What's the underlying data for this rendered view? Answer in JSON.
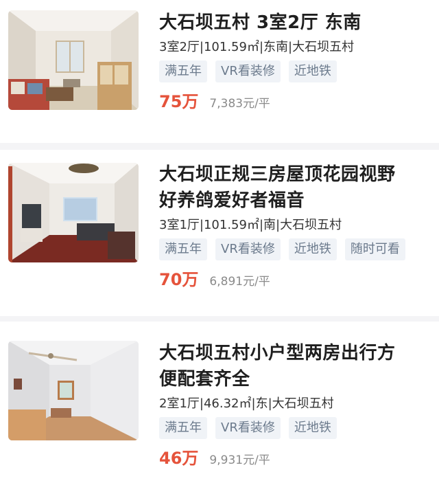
{
  "listings": [
    {
      "title": "大石坝五村 3室2厅 东南",
      "meta": "3室2厅|101.59㎡|东南|大石坝五村",
      "tags": [
        "满五年",
        "VR看装修",
        "近地铁"
      ],
      "price": "75万",
      "unit_price": "7,383元/平",
      "photo": "living-room-photo"
    },
    {
      "title": "大石坝正规三房屋顶花园视野好养鸽爱好者福音",
      "title_line1": "大石坝正规三房屋顶花园视野",
      "title_line2": "好养鸽爱好者福音",
      "meta": "3室1厅|101.59㎡|南|大石坝五村",
      "tags": [
        "满五年",
        "VR看装修",
        "近地铁",
        "随时可看"
      ],
      "price": "70万",
      "unit_price": "6,891元/平",
      "photo": "living-room-photo"
    },
    {
      "title": "大石坝五村小户型两房出行方便配套齐全",
      "title_line1": "大石坝五村小户型两房出行方",
      "title_line2": "便配套齐全",
      "meta": "2室1厅|46.32㎡|东|大石坝五村",
      "tags": [
        "满五年",
        "VR看装修",
        "近地铁"
      ],
      "price": "46万",
      "unit_price": "9,931元/平",
      "photo": "room-photo"
    }
  ],
  "colors": {
    "price": "#e5533b",
    "tag_bg": "#f0f3f7",
    "tag_text": "#6b7a8c"
  }
}
